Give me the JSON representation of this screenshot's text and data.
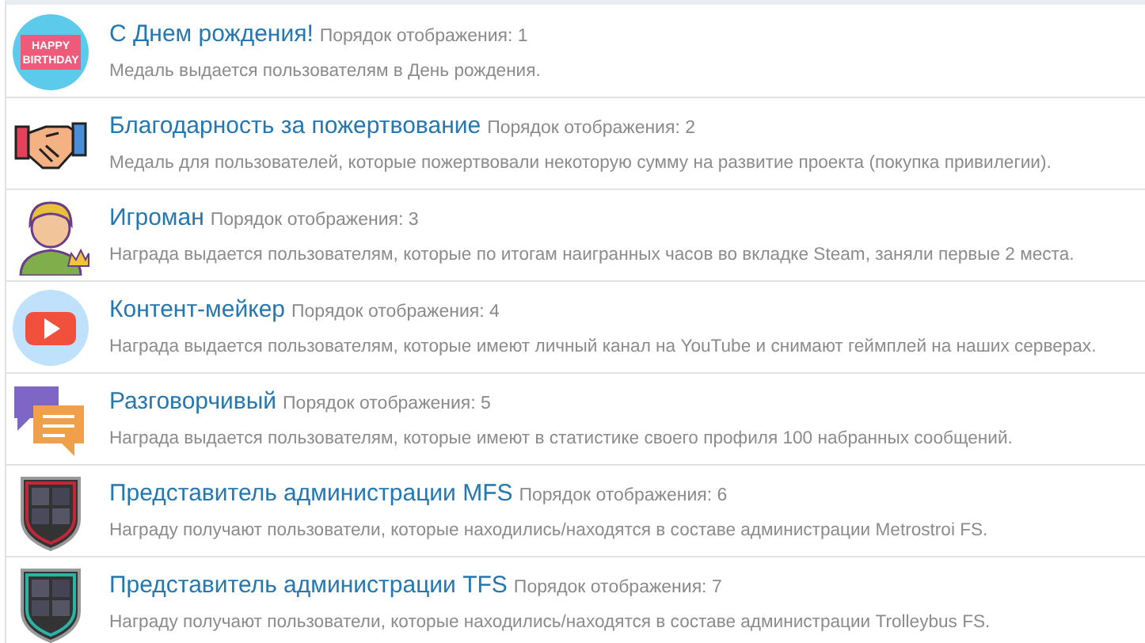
{
  "medals": [
    {
      "kind": "birthday",
      "title": "С Днем рождения!",
      "order": "Порядок отображения: 1",
      "description": "Медаль выдается пользователям в День рождения.",
      "icon_text": [
        "HAPPY",
        "BIRTHDAY"
      ]
    },
    {
      "kind": "handshake",
      "title": "Благодарность за пожертвование",
      "order": "Порядок отображения: 2",
      "description": "Медаль для пользователей, которые пожертвовали некоторую сумму на развитие проекта (покупка привилегии)."
    },
    {
      "kind": "gamer",
      "title": "Игроман",
      "order": "Порядок отображения: 3",
      "description": "Награда выдается пользователям, которые по итогам наигранных часов во вкладке Steam, заняли первые 2 места."
    },
    {
      "kind": "video",
      "title": "Контент-мейкер",
      "order": "Порядок отображения: 4",
      "description": "Награда выдается пользователям, которые имеют личный канал на YouTube и снимают геймплей на наших серверах."
    },
    {
      "kind": "chat",
      "title": "Разговорчивый",
      "order": "Порядок отображения: 5",
      "description": "Награда выдается пользователям, которые имеют в статистике своего профиля 100 набранных сообщений."
    },
    {
      "kind": "shield",
      "color": "#c0283a",
      "title": "Представитель администрации MFS",
      "order": "Порядок отображения: 6",
      "description": "Награду получают пользователи, которые находились/находятся в составе администрации Metrostroi FS."
    },
    {
      "kind": "shield",
      "color": "#2bb3a6",
      "title": "Представитель администрации TFS",
      "order": "Порядок отображения: 7",
      "description": "Награду получают пользователи, которые находились/находятся в составе администрации Trolleybus FS."
    }
  ]
}
